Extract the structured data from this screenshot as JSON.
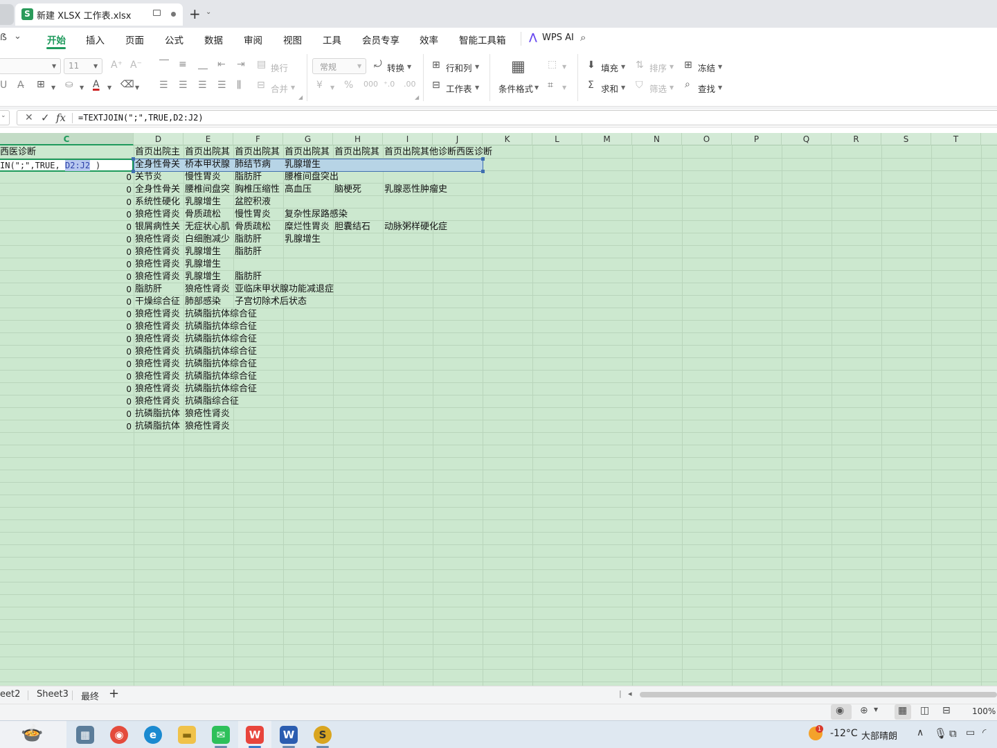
{
  "window": {
    "file_name": "新建 XLSX 工作表.xlsx",
    "app_letter": "S"
  },
  "menu": {
    "items": [
      "开始",
      "插入",
      "页面",
      "公式",
      "数据",
      "审阅",
      "视图",
      "工具",
      "会员专享",
      "效率",
      "智能工具箱"
    ],
    "active": "开始",
    "wps_ai": "WPS AI"
  },
  "ribbon": {
    "font_size": "11",
    "wrap_text": "换行",
    "merge": "合并",
    "number_format": "常规",
    "convert": "转换",
    "rows_cols": "行和列",
    "worksheet": "工作表",
    "conditional_format": "条件格式",
    "fill": "填充",
    "sort": "排序",
    "freeze": "冻结",
    "sum": "求和",
    "filter": "筛选",
    "find": "查找"
  },
  "formula_bar": {
    "fx": "fx",
    "formula": "=TEXTJOIN(\";\",TRUE,D2:J2)"
  },
  "columns": [
    "C",
    "D",
    "E",
    "F",
    "G",
    "H",
    "I",
    "J",
    "K",
    "L",
    "M",
    "N",
    "O",
    "P",
    "Q",
    "R",
    "S",
    "T"
  ],
  "grid": {
    "c1": "西医诊断",
    "c2_edit_prefix": "IN(\";\",TRUE,",
    "c2_edit_ref": "D2:J2",
    "c2_edit_suffix": ")",
    "header_d": "首页出院主",
    "header_e": "首页出院其",
    "header_f": "首页出院其",
    "header_g": "首页出院其",
    "header_h": "首页出院其",
    "header_i": "首页出院其他诊断西医诊断",
    "rows": [
      {
        "c": "",
        "d": "全身性骨关",
        "e": "桥本甲状腺",
        "f": "肺结节病",
        "g": "乳腺增生",
        "h": "",
        "i": ""
      },
      {
        "c": "0",
        "d": "关节炎",
        "e": "慢性胃炎",
        "f": "脂肪肝",
        "g": "腰椎间盘突出",
        "h": "",
        "i": ""
      },
      {
        "c": "0",
        "d": "全身性骨关",
        "e": "腰椎间盘突",
        "f": "胸椎压缩性",
        "g": "高血压",
        "h": "脑梗死",
        "i": "乳腺恶性肿瘤史"
      },
      {
        "c": "0",
        "d": "系统性硬化",
        "e": "乳腺增生",
        "f": "盆腔积液",
        "g": "",
        "h": "",
        "i": ""
      },
      {
        "c": "0",
        "d": "狼疮性肾炎",
        "e": "骨质疏松",
        "f": "慢性胃炎",
        "g": "复杂性尿路感染",
        "h": "",
        "i": ""
      },
      {
        "c": "0",
        "d": "银屑病性关",
        "e": "无症状心肌",
        "f": "骨质疏松",
        "g": "糜烂性胃炎",
        "h": "胆囊结石",
        "i": "动脉粥样硬化症"
      },
      {
        "c": "0",
        "d": "狼疮性肾炎",
        "e": "白细胞减少",
        "f": "脂肪肝",
        "g": "乳腺增生",
        "h": "",
        "i": ""
      },
      {
        "c": "0",
        "d": "狼疮性肾炎",
        "e": "乳腺增生",
        "f": "脂肪肝",
        "g": "",
        "h": "",
        "i": ""
      },
      {
        "c": "0",
        "d": "狼疮性肾炎",
        "e": "乳腺增生",
        "f": "",
        "g": "",
        "h": "",
        "i": ""
      },
      {
        "c": "0",
        "d": "狼疮性肾炎",
        "e": "乳腺增生",
        "f": "脂肪肝",
        "g": "",
        "h": "",
        "i": ""
      },
      {
        "c": "0",
        "d": "脂肪肝",
        "e": "狼疮性肾炎",
        "f": "亚临床甲状腺功能减退症",
        "g": "",
        "h": "",
        "i": ""
      },
      {
        "c": "0",
        "d": "干燥综合征",
        "e": "肺部感染",
        "f": "子宫切除术后状态",
        "g": "",
        "h": "",
        "i": ""
      },
      {
        "c": "0",
        "d": "狼疮性肾炎",
        "e": "抗磷脂抗体综合征",
        "f": "",
        "g": "",
        "h": "",
        "i": ""
      },
      {
        "c": "0",
        "d": "狼疮性肾炎",
        "e": "抗磷脂抗体综合征",
        "f": "",
        "g": "",
        "h": "",
        "i": ""
      },
      {
        "c": "0",
        "d": "狼疮性肾炎",
        "e": "抗磷脂抗体综合征",
        "f": "",
        "g": "",
        "h": "",
        "i": ""
      },
      {
        "c": "0",
        "d": "狼疮性肾炎",
        "e": "抗磷脂抗体综合征",
        "f": "",
        "g": "",
        "h": "",
        "i": ""
      },
      {
        "c": "0",
        "d": "狼疮性肾炎",
        "e": "抗磷脂抗体综合征",
        "f": "",
        "g": "",
        "h": "",
        "i": ""
      },
      {
        "c": "0",
        "d": "狼疮性肾炎",
        "e": "抗磷脂抗体综合征",
        "f": "",
        "g": "",
        "h": "",
        "i": ""
      },
      {
        "c": "0",
        "d": "狼疮性肾炎",
        "e": "抗磷脂抗体综合征",
        "f": "",
        "g": "",
        "h": "",
        "i": ""
      },
      {
        "c": "0",
        "d": "狼疮性肾炎",
        "e": "抗磷脂综合征",
        "f": "",
        "g": "",
        "h": "",
        "i": ""
      },
      {
        "c": "0",
        "d": "抗磷脂抗体",
        "e": "狼疮性肾炎",
        "f": "",
        "g": "",
        "h": "",
        "i": ""
      },
      {
        "c": "0",
        "d": "抗磷脂抗体",
        "e": "狼疮性肾炎",
        "f": "",
        "g": "",
        "h": "",
        "i": ""
      }
    ]
  },
  "sheets": [
    "eet2",
    "Sheet3",
    "最终"
  ],
  "status": {
    "zoom": "100%"
  },
  "taskbar": {
    "weather_temp": "-12°C",
    "weather_desc": "大部晴朗",
    "weather_badge": "1"
  }
}
